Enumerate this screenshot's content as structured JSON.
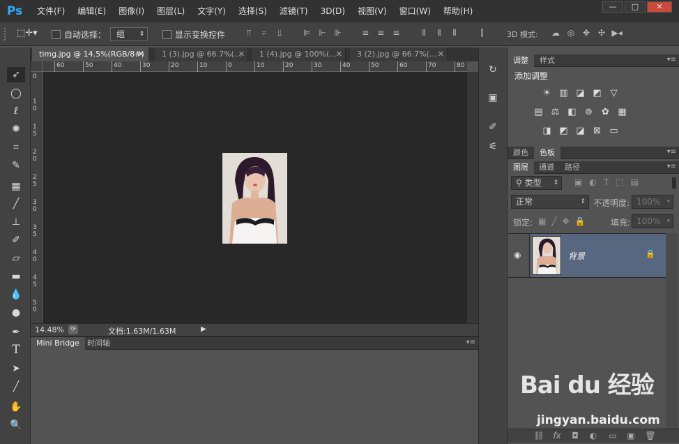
{
  "app": {
    "logo": "Ps"
  },
  "menu": [
    "文件(F)",
    "编辑(E)",
    "图像(I)",
    "图层(L)",
    "文字(Y)",
    "选择(S)",
    "滤镜(T)",
    "3D(D)",
    "视图(V)",
    "窗口(W)",
    "帮助(H)"
  ],
  "window_controls": {
    "minimize": "—",
    "restore": "□",
    "close": "✕"
  },
  "options": {
    "auto_select_label": "自动选择：",
    "auto_select_value": "组",
    "transform_label": "显示变换控件",
    "mode_3d_label": "3D 模式:"
  },
  "doc_tabs": [
    {
      "label": "timg.jpg @ 14.5%(RGB/8#)",
      "close": "✕"
    },
    {
      "label": "1 (3).jpg @ 66.7%(...",
      "close": "✕"
    },
    {
      "label": "1 (4).jpg @ 100%(...",
      "close": "✕"
    },
    {
      "label": "3 (2).jpg @ 66.7%(...",
      "close": "✕"
    }
  ],
  "ruler_top": [
    "60",
    "50",
    "40",
    "30",
    "20",
    "10",
    "0",
    "10",
    "20",
    "30",
    "40",
    "50",
    "60",
    "70",
    "80"
  ],
  "ruler_left": [
    "0",
    "1\n0",
    "1\n5",
    "2\n0",
    "2\n5",
    "3\n0",
    "3\n5",
    "4\n0",
    "4\n5",
    "5\n0"
  ],
  "status": {
    "zoom": "14.48%",
    "doc_info": "文档:1.63M/1.63M",
    "arrow": "▶"
  },
  "bottom_tabs": {
    "mini_bridge": "Mini Bridge",
    "timeline": "时间轴"
  },
  "adjustments": {
    "tab_adjust": "调整",
    "tab_styles": "样式",
    "add_adjustment": "添加调整",
    "row1": [
      "☀",
      "▥",
      "◪",
      "◩",
      "▽"
    ],
    "row2": [
      "▤",
      "⚖",
      "◧",
      "⊚",
      "✿",
      "▦"
    ],
    "row3": [
      "◨",
      "◩",
      "◪",
      "⊠",
      "▭"
    ]
  },
  "color_tabs": {
    "color": "颜色",
    "swatches": "色板"
  },
  "layers_panel": {
    "tab_layers": "图层",
    "tab_channels": "通道",
    "tab_paths": "路径",
    "filter_kind": "类型",
    "blend_mode": "正常",
    "opacity_label": "不透明度:",
    "opacity_value": "100%",
    "lock_label": "锁定:",
    "fill_label": "填充:",
    "fill_value": "100%",
    "layer_name": "背景"
  },
  "footer_icons": [
    "⛓",
    "fx",
    "◘",
    "◐",
    "▭",
    "▣",
    "🗑"
  ],
  "watermark": {
    "brand": "Bai du 经验",
    "url": "jingyan.baidu.com"
  },
  "colors": {
    "accent": "#31a8ff",
    "selected_layer": "#586780"
  }
}
